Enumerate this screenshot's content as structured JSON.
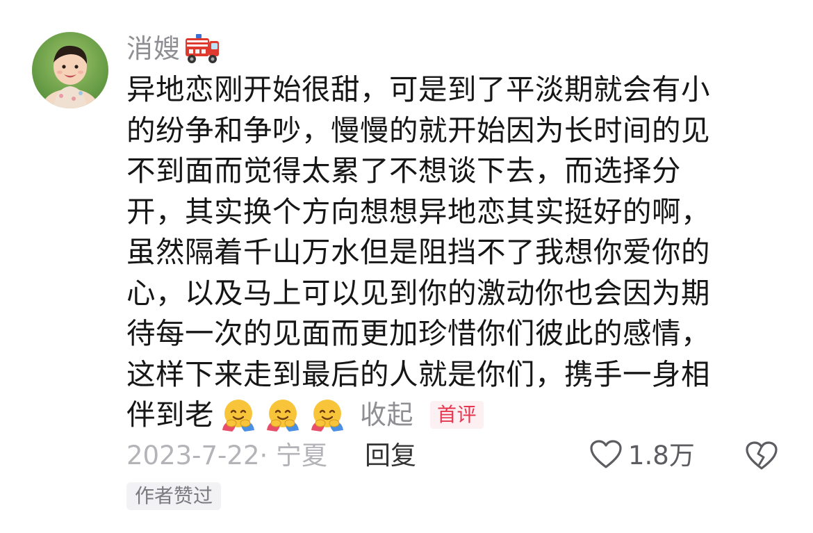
{
  "comment": {
    "username": "消嫂",
    "username_emoji": "fire-truck-emoji",
    "content_lines": [
      "异地恋刚开始很甜，可是到了平淡期就会有小",
      "的纷争和争吵，慢慢的就开始因为长时间的见",
      "不到面而觉得太累了不想谈下去，而选择分",
      "开，其实换个方向想想异地恋其实挺好的啊，",
      "虽然隔着千山万水但是阻挡不了我想你爱你的",
      "心，以及马上可以见到你的激动你也会因为期",
      "待每一次的见面而更加珍惜你们彼此的感情，",
      "这样下来走到最后的人就是你们，携手一身相"
    ],
    "last_line_text": "伴到老",
    "emoji_names": [
      "hugging-face-emoji",
      "hugging-face-emoji",
      "hugging-face-emoji"
    ],
    "collapse_label": "收起",
    "badge_label": "首评",
    "date_location": "2023-7-22· 宁夏",
    "reply_label": "回复",
    "like_count": "1.8万",
    "author_liked_label": "作者赞过"
  },
  "colors": {
    "text": "#161616",
    "muted": "#8e8e93",
    "badge_bg": "#fdf0f2",
    "badge_text": "#e8354f"
  }
}
